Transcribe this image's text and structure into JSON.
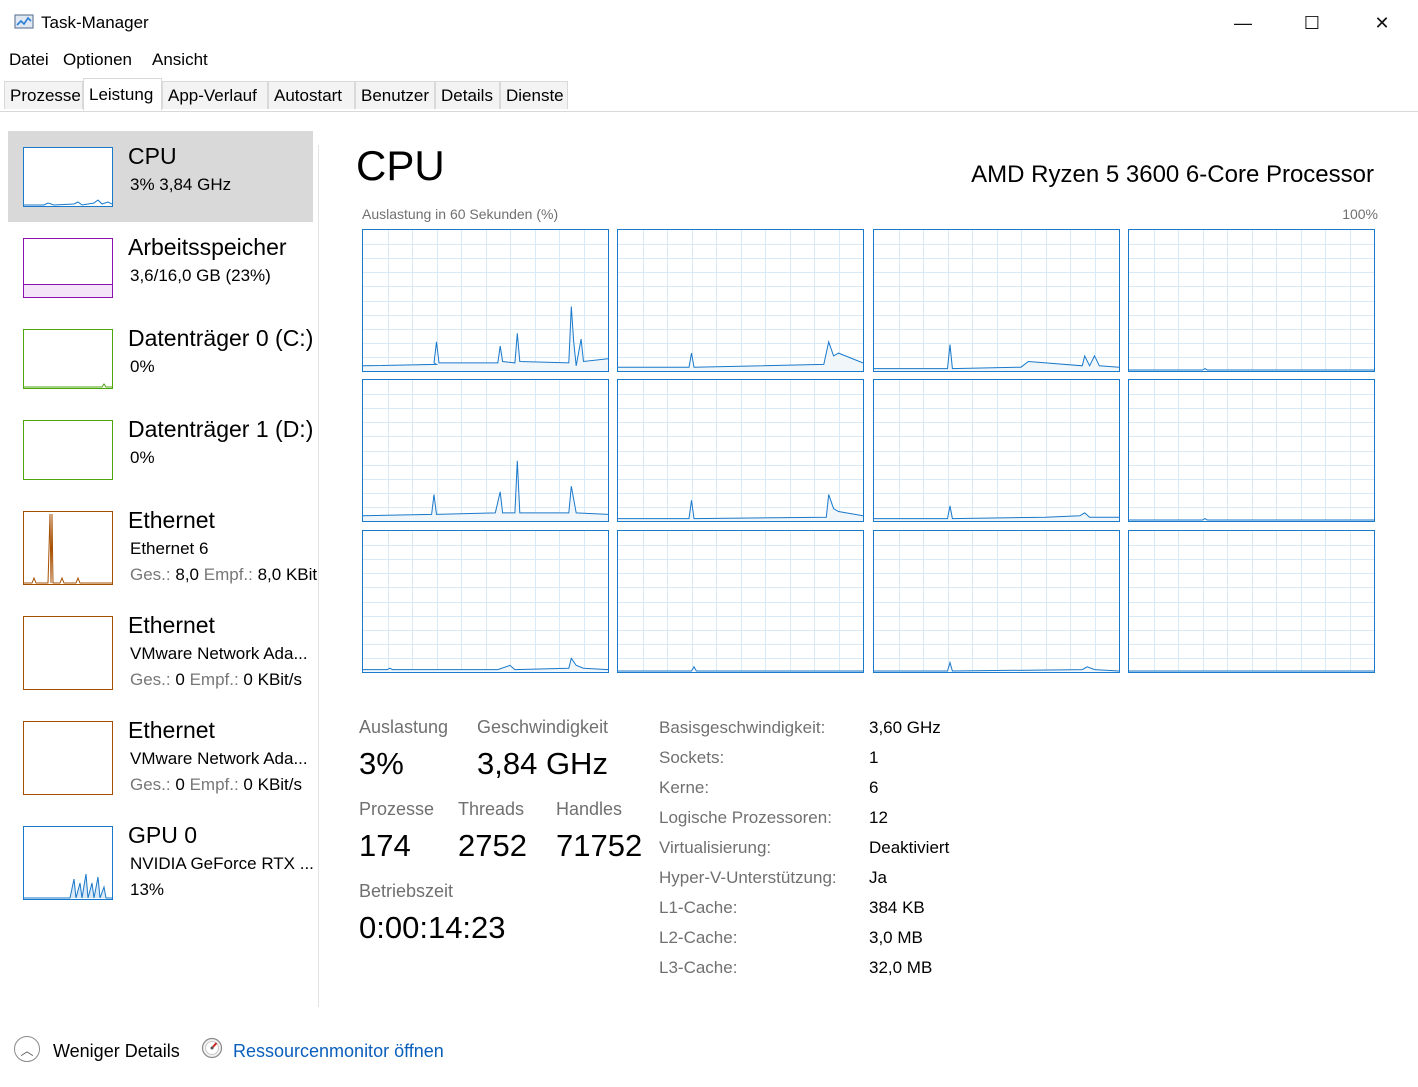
{
  "window": {
    "title": "Task-Manager",
    "minimize": "—",
    "maximize": "☐",
    "close": "✕"
  },
  "menu": [
    "Datei",
    "Optionen",
    "Ansicht"
  ],
  "tabs": [
    "Prozesse",
    "Leistung",
    "App-Verlauf",
    "Autostart",
    "Benutzer",
    "Details",
    "Dienste"
  ],
  "active_tab": "Leistung",
  "sidebar": {
    "items": [
      {
        "title": "CPU",
        "line1": "3%  3,84 GHz",
        "line2": "",
        "color": "#1979ca",
        "selected": true,
        "icon": "cpu-graph"
      },
      {
        "title": "Arbeitsspeicher",
        "line1": "3,6/16,0 GB (23%)",
        "line2": "",
        "color": "#8b12ae",
        "icon": "memory-graph"
      },
      {
        "title": "Datenträger 0 (C:)",
        "line1": "0%",
        "line2": "",
        "color": "#4da60c",
        "icon": "disk-graph"
      },
      {
        "title": "Datenträger 1 (D:)",
        "line1": "0%",
        "line2": "",
        "color": "#4da60c",
        "icon": "disk-graph"
      },
      {
        "title": "Ethernet",
        "line1": "Ethernet 6",
        "line2_sent_label": "Ges.:",
        "line2_sent": "8,0",
        "line2_recv_label": "Empf.:",
        "line2_recv": "8,0 KBit",
        "color": "#a74f01",
        "icon": "network-graph"
      },
      {
        "title": "Ethernet",
        "line1": "VMware Network Ada...",
        "line2_sent_label": "Ges.:",
        "line2_sent": "0",
        "line2_recv_label": "Empf.:",
        "line2_recv": "0 KBit/s",
        "color": "#a74f01",
        "icon": "network-graph"
      },
      {
        "title": "Ethernet",
        "line1": "VMware Network Ada...",
        "line2_sent_label": "Ges.:",
        "line2_sent": "0",
        "line2_recv_label": "Empf.:",
        "line2_recv": "0 KBit/s",
        "color": "#a74f01",
        "icon": "network-graph"
      },
      {
        "title": "GPU 0",
        "line1": "NVIDIA GeForce RTX ...",
        "line2": "13%",
        "color": "#1979ca",
        "icon": "gpu-graph"
      }
    ]
  },
  "main": {
    "title": "CPU",
    "model": "AMD Ryzen 5 3600 6-Core Processor",
    "graph_label": "Auslastung in 60 Sekunden (%)",
    "graph_max": "100%",
    "graph_color": "#1979ca"
  },
  "stats": {
    "utilization_label": "Auslastung",
    "utilization": "3%",
    "speed_label": "Geschwindigkeit",
    "speed": "3,84 GHz",
    "processes_label": "Prozesse",
    "processes": "174",
    "threads_label": "Threads",
    "threads": "2752",
    "handles_label": "Handles",
    "handles": "71752",
    "uptime_label": "Betriebszeit",
    "uptime": "0:00:14:23"
  },
  "info": [
    {
      "label": "Basisgeschwindigkeit:",
      "value": "3,60 GHz"
    },
    {
      "label": "Sockets:",
      "value": "1"
    },
    {
      "label": "Kerne:",
      "value": "6"
    },
    {
      "label": "Logische Prozessoren:",
      "value": "12"
    },
    {
      "label": "Virtualisierung:",
      "value": "Deaktiviert"
    },
    {
      "label": "Hyper-V-Unterstützung:",
      "value": "Ja"
    },
    {
      "label": "L1-Cache:",
      "value": "384 KB"
    },
    {
      "label": "L2-Cache:",
      "value": "3,0 MB"
    },
    {
      "label": "L3-Cache:",
      "value": "32,0 MB"
    }
  ],
  "footer": {
    "less_details": "Weniger Details",
    "resource_monitor": "Ressourcenmonitor öffnen"
  }
}
